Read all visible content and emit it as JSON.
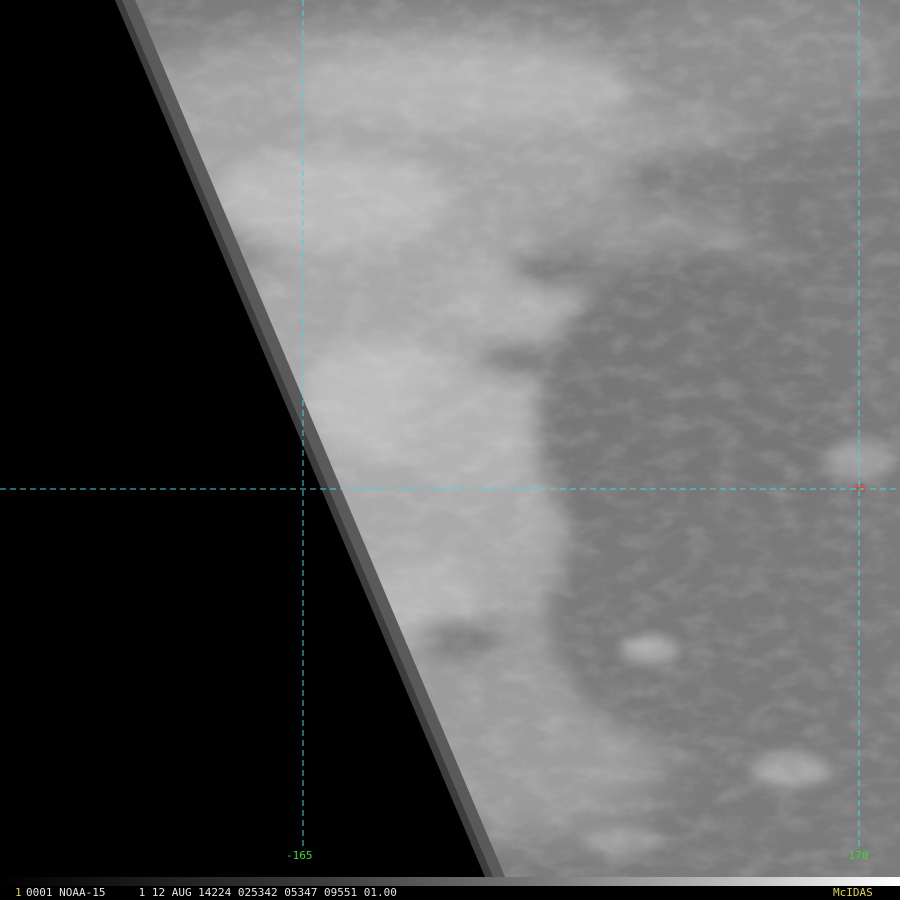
{
  "colors": {
    "grid_line": "#3fd9d9",
    "lon_label": "#35d935",
    "lat_label": "#e03a3a",
    "info_text": "#e6e6e6",
    "frame_number": "#e0d640",
    "brand_text": "#e0d640",
    "space_background": "#000000",
    "cloud_light": "#c4c4c4",
    "ocean_gray": "#7c7c7c"
  },
  "image": {
    "kind": "satellite-infrared-imagery"
  },
  "labels": {
    "lon_left": "-165",
    "lon_right": "-170",
    "lat": "35"
  },
  "footer": {
    "frame_number": "1",
    "info": "0001 NOAA-15     1 12 AUG 14224 025342 05347 09551 01.00",
    "brand": "McIDAS"
  }
}
